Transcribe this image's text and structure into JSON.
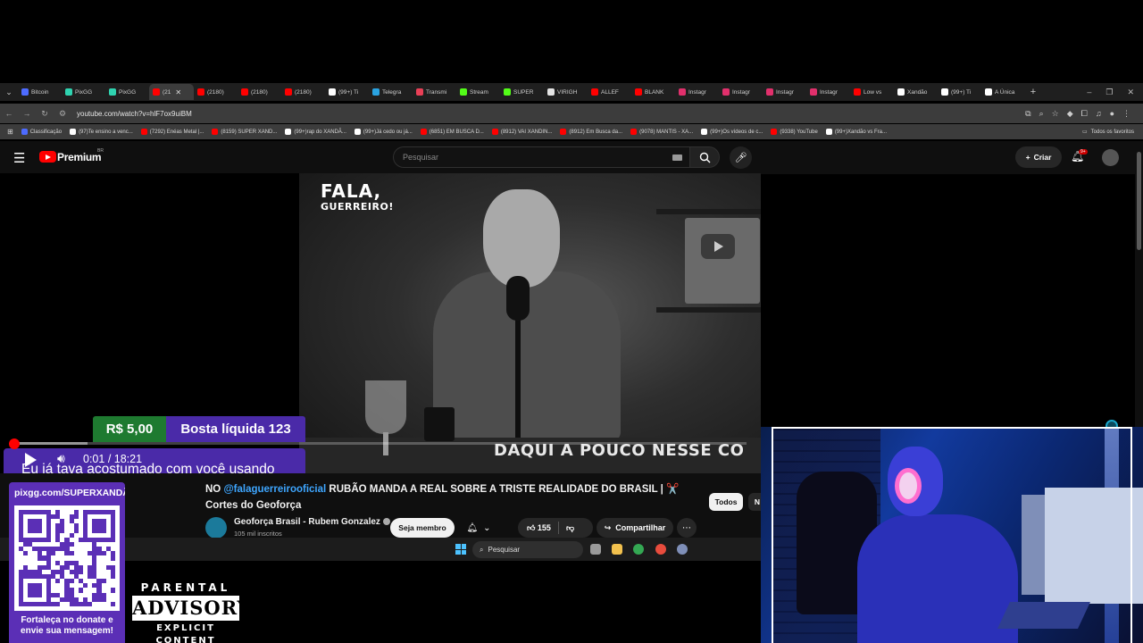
{
  "tabs": [
    {
      "label": "Bitcoin",
      "color": "#4d6bff"
    },
    {
      "label": "PixGG",
      "color": "#2fd3b0"
    },
    {
      "label": "PixGG",
      "color": "#2fd3b0"
    },
    {
      "label": "(21",
      "color": "#ff0000",
      "active": true
    },
    {
      "label": "(2180)",
      "color": "#ff0000"
    },
    {
      "label": "(2180)",
      "color": "#ff0000"
    },
    {
      "label": "(2180)",
      "color": "#ff0000"
    },
    {
      "label": "(99+) Ti",
      "color": "#ffffff"
    },
    {
      "label": "Telegra",
      "color": "#2aa3e1"
    },
    {
      "label": "Transmi",
      "color": "#e94057"
    },
    {
      "label": "Stream",
      "color": "#53fc18"
    },
    {
      "label": "SUPER",
      "color": "#53fc18"
    },
    {
      "label": "VIRIGH",
      "color": "#e4e4e4"
    },
    {
      "label": "ALLEF",
      "color": "#ff0000"
    },
    {
      "label": "BLANK",
      "color": "#ff0000"
    },
    {
      "label": "Instagr",
      "color": "#e1306c"
    },
    {
      "label": "Instagr",
      "color": "#e1306c"
    },
    {
      "label": "Instagr",
      "color": "#e1306c"
    },
    {
      "label": "Instagr",
      "color": "#e1306c"
    },
    {
      "label": "Low vs",
      "color": "#ff0000"
    },
    {
      "label": "Xandão",
      "color": "#ffffff"
    },
    {
      "label": "(99+) Ti",
      "color": "#ffffff"
    },
    {
      "label": "A Única",
      "color": "#ffffff"
    }
  ],
  "address": {
    "url": "youtube.com/watch?v=hlF7ox9uiBM"
  },
  "bookmarks": [
    {
      "label": "Classificação",
      "color": "#4d6bff"
    },
    {
      "label": "(97)Te ensino a venc...",
      "color": "#ffffff"
    },
    {
      "label": "(7292) Enéas Metal |...",
      "color": "#ff0000"
    },
    {
      "label": "(8159) SUPER XAND...",
      "color": "#ff0000"
    },
    {
      "label": "(99+)rap do XANDÃ...",
      "color": "#ffffff"
    },
    {
      "label": "(99+)Já cedo ou já...",
      "color": "#ffffff"
    },
    {
      "label": "(6851) EM BUSCA D...",
      "color": "#ff0000"
    },
    {
      "label": "(8912) VAI XANDIN...",
      "color": "#ff0000"
    },
    {
      "label": "(8912) Em Busca da...",
      "color": "#ff0000"
    },
    {
      "label": "(9078) MANTIS - XA...",
      "color": "#ff0000"
    },
    {
      "label": "(99+)Os vídeos de c...",
      "color": "#ffffff"
    },
    {
      "label": "(9338) YouTube",
      "color": "#ff0000"
    },
    {
      "label": "(99+)Xandão vs Fra...",
      "color": "#ffffff"
    }
  ],
  "bookmarks_all": "Todos os favoritos",
  "yt": {
    "brand": "Premium",
    "region": "BR",
    "search_placeholder": "Pesquisar",
    "create_label": "Criar",
    "notif_count": "9+"
  },
  "video": {
    "logo_line1": "FALA,",
    "logo_line2": "GUERREIRO!",
    "caption": "DAQUI A POUCO NESSE CO",
    "current_time": "0:01",
    "separator": " / ",
    "duration": "18:21",
    "progress_played": 0.001,
    "progress_buffered": 0.1
  },
  "donation": {
    "amount": "R$ 5,00",
    "name": "Bosta líquida 123",
    "message": "Eu já tava acostumado com você usando camisa social nas lives, agora voltou com aquela Skin lendária de..."
  },
  "info": {
    "title_prefix": "NO ",
    "mention": "@falaguerreirooficial",
    "title_rest": " RUBÃO MANDA A REAL SOBRE A TRISTE REALIDADE DO BRASIL | ✂️ Cortes do Geoforça",
    "channel": "Geoforça Brasil - Rubem Gonzalez",
    "subscribers": "105 mil inscritos",
    "member_label": "Seja membro",
    "likes": "155",
    "share_label": "Compartilhar",
    "chip_all": "Todos",
    "chip_next": "N"
  },
  "taskbar": {
    "search_label": "Pesquisar"
  },
  "overlay": {
    "pix_url": "pixgg.com/SUPERXANDÃO",
    "qr_caption_line1": "Fortaleça no donate e",
    "qr_caption_line2": "envie sua mensagem!",
    "advisory_top": "PARENTAL",
    "advisory_mid": "ADVISORY",
    "advisory_bot": "EXPLICIT CONTENT"
  }
}
